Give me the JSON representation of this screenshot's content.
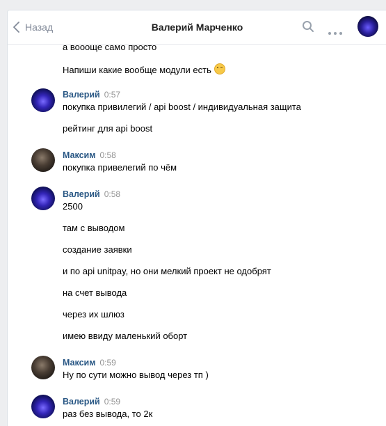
{
  "header": {
    "back_label": "Назад",
    "title": "Валерий Марченко",
    "icons": [
      "search-icon",
      "more-icon",
      "avatar"
    ]
  },
  "colors": {
    "author": "#2a5885",
    "time": "#939393",
    "back": "#828a99",
    "background": "#edeef0"
  },
  "messages": {
    "m0": {
      "text": "а воооще само просто"
    },
    "m1": {
      "text": "Напиши какие вообще модули есть",
      "emoji": "winking-face-icon"
    },
    "g1": {
      "author": "Валерий",
      "time": "0:57",
      "lines": [
        "покупка привилегий / api boost / индивидуальная защита",
        "рейтинг для api boost"
      ]
    },
    "g2": {
      "author": "Максим",
      "time": "0:58",
      "lines": [
        "покупка привелегий по чём"
      ]
    },
    "g3": {
      "author": "Валерий",
      "time": "0:58",
      "lines": [
        "2500",
        "там с выводом",
        "создание заявки",
        "и по api unitpay, но они мелкий проект не одобрят",
        "на счет вывода",
        "через их шлюз",
        "имею ввиду маленький оборт"
      ]
    },
    "g4": {
      "author": "Максим",
      "time": "0:59",
      "lines": [
        "Ну по сути можно вывод через тп )"
      ]
    },
    "g5": {
      "author": "Валерий",
      "time": "0:59",
      "lines": [
        "раз без вывода, то 2к"
      ]
    }
  }
}
